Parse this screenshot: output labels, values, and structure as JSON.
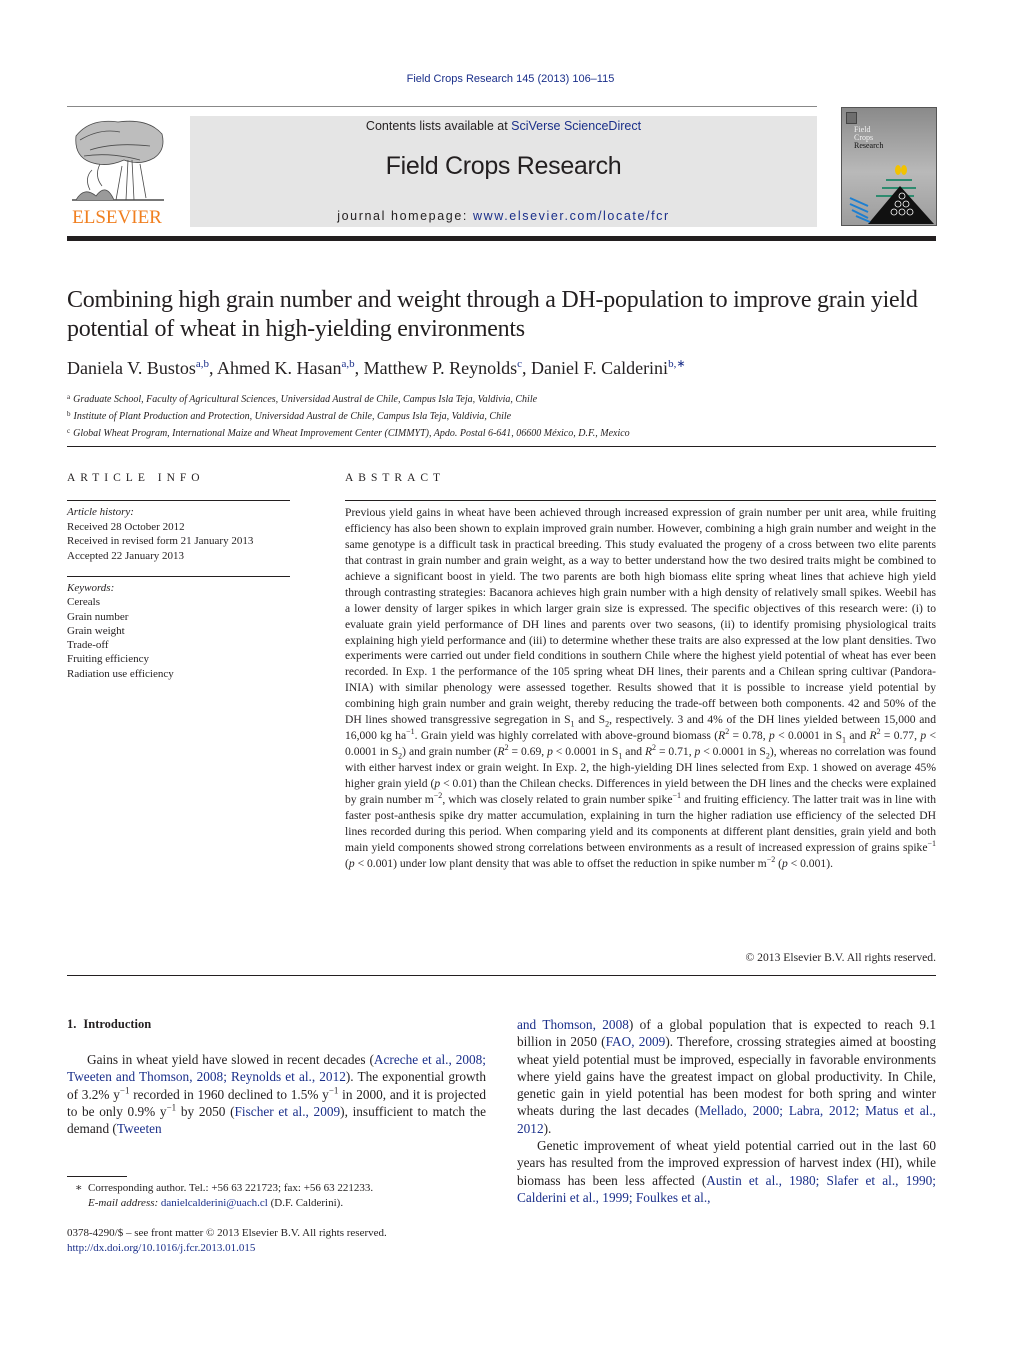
{
  "header": {
    "citation": "Field Crops Research 145 (2013) 106–115",
    "publisher_logo_text": "ELSEVIER",
    "contents_prefix": "Contents lists available at ",
    "contents_link": "SciVerse ScienceDirect",
    "journal_title": "Field Crops Research",
    "homepage_prefix": "journal homepage: ",
    "homepage_link": "www.elsevier.com/locate/fcr",
    "cover_lines": [
      "Field",
      "Crops",
      "Research"
    ],
    "colors": {
      "link": "#1a2f8a",
      "elsevier_orange": "#f07f20",
      "masthead_bg": "#e5e5e5"
    }
  },
  "article": {
    "title": "Combining high grain number and weight through a DH-population to improve grain yield potential of wheat in high-yielding environments",
    "authors": [
      {
        "name": "Daniela V. Bustos",
        "affil": "a,b",
        "sep": ", "
      },
      {
        "name": "Ahmed K. Hasan",
        "affil": "a,b",
        "sep": ", "
      },
      {
        "name": "Matthew P. Reynolds",
        "affil": "c",
        "sep": ", "
      },
      {
        "name": "Daniel F. Calderini",
        "affil": "b,∗",
        "sep": ""
      }
    ],
    "affiliations": [
      {
        "key": "a",
        "text": "Graduate School, Faculty of Agricultural Sciences, Universidad Austral de Chile, Campus Isla Teja, Valdivia, Chile"
      },
      {
        "key": "b",
        "text": "Institute of Plant Production and Protection, Universidad Austral de Chile, Campus Isla Teja, Valdivia, Chile"
      },
      {
        "key": "c",
        "text": "Global Wheat Program, International Maize and Wheat Improvement Center (CIMMYT), Apdo. Postal 6-641, 06600 México, D.F., Mexico"
      }
    ]
  },
  "article_info": {
    "heading": "ARTICLE INFO",
    "history_label": "Article history:",
    "history": [
      "Received 28 October 2012",
      "Received in revised form 21 January 2013",
      "Accepted 22 January 2013"
    ],
    "keywords_label": "Keywords:",
    "keywords": [
      "Cereals",
      "Grain number",
      "Grain weight",
      "Trade-off",
      "Fruiting efficiency",
      "Radiation use efficiency"
    ]
  },
  "abstract": {
    "heading": "ABSTRACT",
    "segments": [
      "Previous yield gains in wheat have been achieved through increased expression of grain number per unit area, while fruiting efficiency has also been shown to explain improved grain number. However, combining a high grain number and weight in the same genotype is a difficult task in practical breeding. This study evaluated the progeny of a cross between two elite parents that contrast in grain number and grain weight, as a way to better understand how the two desired traits might be combined to achieve a significant boost in yield. The two parents are both high biomass elite spring wheat lines that achieve high yield through contrasting strategies: Bacanora achieves high grain number with a high density of relatively small spikes. Weebil has a lower density of larger spikes in which larger grain size is expressed. The specific objectives of this research were: (i) to evaluate grain yield performance of DH lines and parents over two seasons, (ii) to identify promising physiological traits explaining high yield performance and (iii) to determine whether these traits are also expressed at the low plant densities. Two experiments were carried out under field conditions in southern Chile where the highest yield potential of wheat has ever been recorded. In Exp. 1 the performance of the 105 spring wheat DH lines, their parents and a Chilean spring cultivar (Pandora-INIA) with similar phenology were assessed together. Results showed that it is possible to increase yield potential by combining high grain number and grain weight, thereby reducing the trade-off between both components. 42 and 50% of the DH lines showed transgressive segregation in S",
      "1",
      " and S",
      "2",
      ", respectively. 3 and 4% of the DH lines yielded between 15,000 and 16,000 kg ha",
      "−1",
      ". Grain yield was highly correlated with above-ground biomass (",
      "R",
      "2",
      " = 0.78, ",
      "p",
      " < 0.0001 in S",
      "1",
      " and ",
      "R",
      "2",
      " = 0.77, ",
      "p",
      " < 0.0001 in S",
      "2",
      ") and grain number (",
      "R",
      "2",
      " = 0.69, ",
      "p",
      " < 0.0001 in S",
      "1",
      " and ",
      "R",
      "2",
      " = 0.71, ",
      "p",
      " < 0.0001 in S",
      "2",
      "), whereas no correlation was found with either harvest index or grain weight. In Exp. 2, the high-yielding DH lines selected from Exp. 1 showed on average 45% higher grain yield (",
      "p",
      " < 0.01) than the Chilean checks. Differences in yield between the DH lines and the checks were explained by grain number m",
      "−2",
      ", which was closely related to grain number spike",
      "−1",
      " and fruiting efficiency. The latter trait was in line with faster post-anthesis spike dry matter accumulation, explaining in turn the higher radiation use efficiency of the selected DH lines recorded during this period. When comparing yield and its components at different plant densities, grain yield and both main yield components showed strong correlations between environments as a result of increased expression of grains spike",
      "−1",
      " (",
      "p",
      " < 0.001) under low plant density that was able to offset the reduction in spike number m",
      "−2",
      " (",
      "p",
      " < 0.001)."
    ],
    "copyright": "© 2013 Elsevier B.V. All rights reserved."
  },
  "introduction": {
    "number": "1.",
    "heading": "Introduction",
    "left": {
      "t1": "Gains in wheat yield have slowed in recent decades (",
      "l1": "Acreche et al., 2008; Tweeten and Thomson, 2008; Reynolds et al., 2012",
      "t2": "). The exponential growth of 3.2% y",
      "s1": "−1",
      "t3": " recorded in 1960 declined to 1.5% y",
      "s2": "−1",
      "t4": " in 2000, and it is projected to be only 0.9% y",
      "s3": "−1",
      "t5": " by 2050 (",
      "l2": "Fischer et al., 2009",
      "t6": "), insufficient to match the demand (",
      "l3": "Tweeten"
    },
    "right": {
      "l1": "and Thomson, 2008",
      "t1": ") of a global population that is expected to reach 9.1 billion in 2050 (",
      "l2": "FAO, 2009",
      "t2": "). Therefore, crossing strategies aimed at boosting wheat yield potential must be improved, especially in favorable environments where yield gains have the greatest impact on global productivity. In Chile, genetic gain in yield potential has been modest for both spring and winter wheats during the last decades (",
      "l3": "Mellado, 2000; Labra, 2012; Matus et al., 2012",
      "t3": ").",
      "p2_t1": "Genetic improvement of wheat yield potential carried out in the last 60 years has resulted from the improved expression of harvest index (HI), while biomass has been less affected (",
      "p2_l1": "Austin et al., 1980; Slafer et al., 1990; Calderini et al., 1999; Foulkes et al.,"
    }
  },
  "footnotes": {
    "marker": "∗",
    "corresponding": "Corresponding author. Tel.: +56 63 221723; fax: +56 63 221233.",
    "email_label": "E-mail address: ",
    "email": "danielcalderini@uach.cl",
    "email_suffix": " (D.F. Calderini).",
    "issn_line": "0378-4290/$ – see front matter © 2013 Elsevier B.V. All rights reserved.",
    "doi": "http://dx.doi.org/10.1016/j.fcr.2013.01.015"
  }
}
